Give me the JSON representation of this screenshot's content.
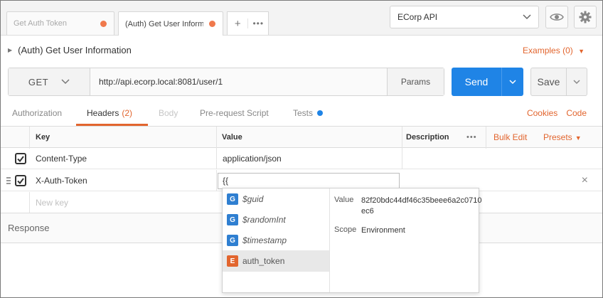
{
  "tabs": [
    {
      "label": "Get Auth Token",
      "dirty": true
    },
    {
      "label": "(Auth) Get User Inform",
      "dirty": true
    }
  ],
  "tab_actions": {
    "add": "+",
    "more": "•••"
  },
  "environment": {
    "selected": "ECorp API"
  },
  "request": {
    "title": "(Auth) Get User Information",
    "examples_label": "Examples (0)",
    "method": "GET",
    "url": "http://api.ecorp.local:8081/user/1",
    "params_label": "Params",
    "send_label": "Send",
    "save_label": "Save"
  },
  "subtabs": {
    "authorization": "Authorization",
    "headers": "Headers",
    "headers_count": "(2)",
    "body": "Body",
    "prerequest": "Pre-request Script",
    "tests": "Tests",
    "cookies": "Cookies",
    "code": "Code"
  },
  "headers_table": {
    "col_key": "Key",
    "col_value": "Value",
    "col_description": "Description",
    "more": "•••",
    "bulk_edit": "Bulk Edit",
    "presets": "Presets",
    "rows": [
      {
        "key": "Content-Type",
        "value": "application/json",
        "checked": true
      },
      {
        "key": "X-Auth-Token",
        "value": "{{",
        "checked": true
      }
    ],
    "new_key_placeholder": "New key"
  },
  "response_label": "Response",
  "autocomplete": {
    "items": [
      {
        "badge": "G",
        "name": "$guid"
      },
      {
        "badge": "G",
        "name": "$randomInt"
      },
      {
        "badge": "G",
        "name": "$timestamp"
      },
      {
        "badge": "E",
        "name": "auth_token"
      }
    ],
    "value_label": "Value",
    "value": "82f20bdc44df46c35beee6a2c0710ec6",
    "scope_label": "Scope",
    "scope": "Environment"
  },
  "colors": {
    "accent": "#e2652e",
    "send": "#1f84e6",
    "global_badge": "#2f7fd1"
  }
}
